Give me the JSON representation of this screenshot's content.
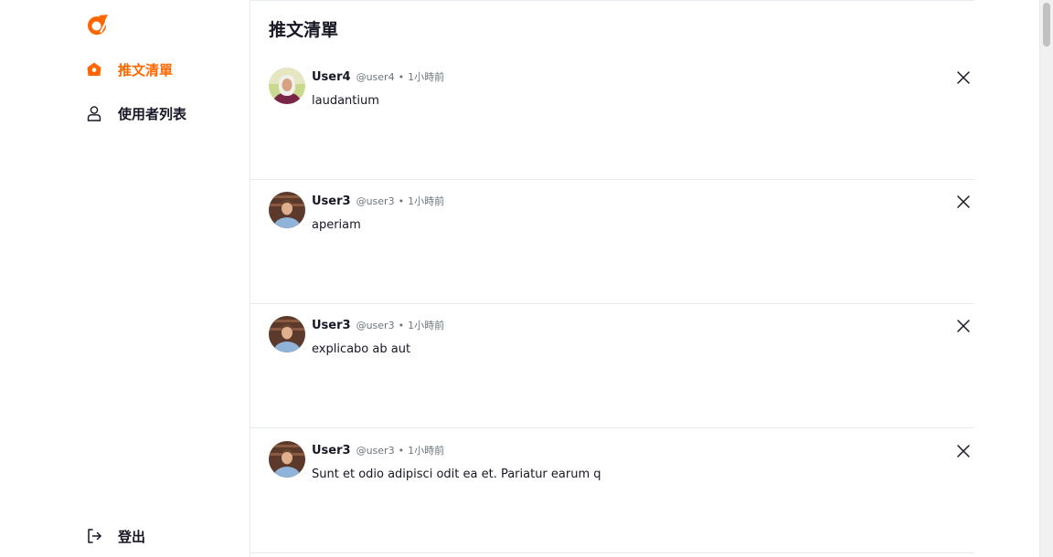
{
  "brand": {
    "accent": "#ff6600",
    "text": "#171725",
    "muted": "#6c757d",
    "logo_icon": "brand-logo-icon"
  },
  "sidebar": {
    "items": [
      {
        "label": "推文清單",
        "icon": "home-icon",
        "active": true
      },
      {
        "label": "使用者列表",
        "icon": "user-icon",
        "active": false
      }
    ],
    "logout": {
      "label": "登出",
      "icon": "logout-icon"
    }
  },
  "main": {
    "title": "推文清單",
    "tweets": [
      {
        "name": "User4",
        "handle": "@user4",
        "separator": "•",
        "time": "1小時前",
        "text": "laudantium",
        "avatar": "user4-avatar"
      },
      {
        "name": "User3",
        "handle": "@user3",
        "separator": "•",
        "time": "1小時前",
        "text": "aperiam",
        "avatar": "user3-avatar"
      },
      {
        "name": "User3",
        "handle": "@user3",
        "separator": "•",
        "time": "1小時前",
        "text": "explicabo ab aut",
        "avatar": "user3-avatar"
      },
      {
        "name": "User3",
        "handle": "@user3",
        "separator": "•",
        "time": "1小時前",
        "text": "Sunt et odio adipisci odit ea et. Pariatur earum q",
        "avatar": "user3-avatar"
      }
    ]
  }
}
